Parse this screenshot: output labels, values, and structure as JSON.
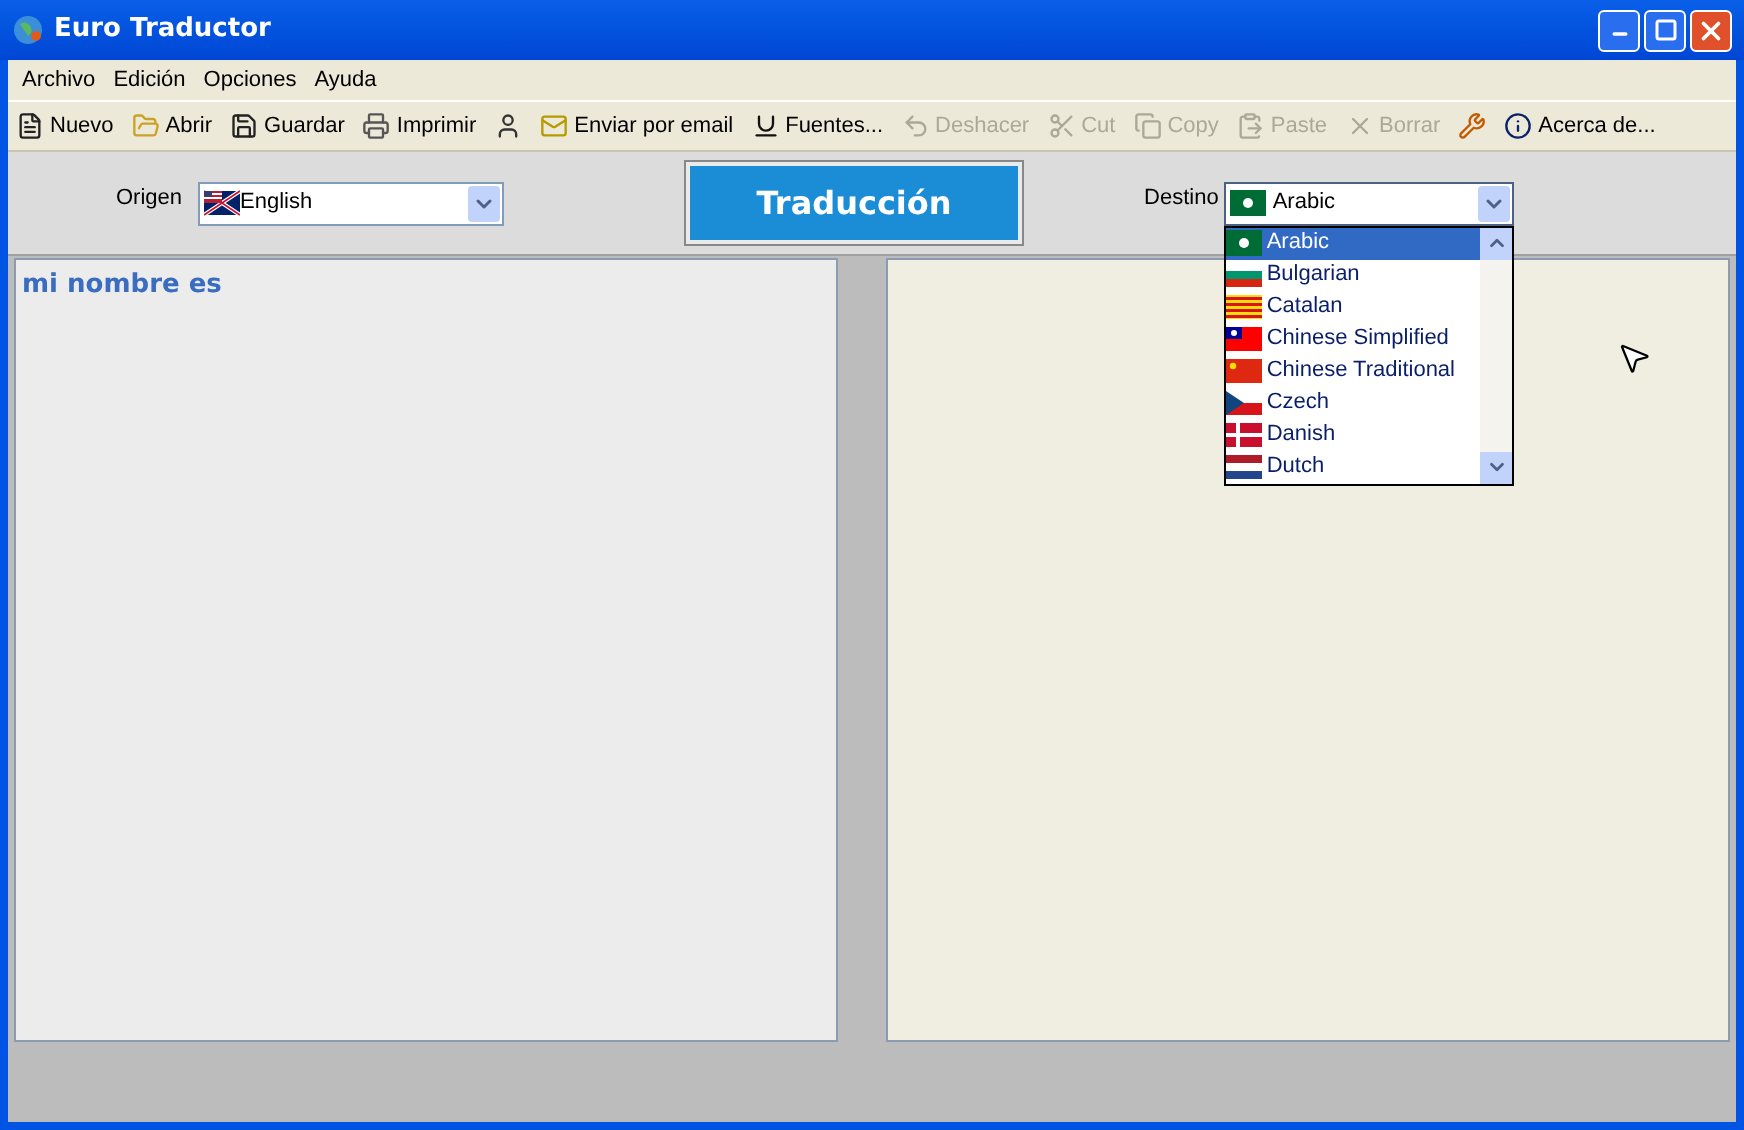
{
  "window": {
    "title": "Euro Traductor"
  },
  "menu": [
    "Archivo",
    "Edición",
    "Opciones",
    "Ayuda"
  ],
  "toolbar": [
    {
      "kind": "new",
      "label": "Nuevo",
      "disabled": false
    },
    {
      "kind": "open",
      "label": "Abrir",
      "disabled": false
    },
    {
      "kind": "save",
      "label": "Guardar",
      "disabled": false
    },
    {
      "kind": "print",
      "label": "Imprimir",
      "disabled": false
    },
    {
      "kind": "user",
      "disabled": false
    },
    {
      "kind": "mail",
      "label": "Enviar por email",
      "disabled": false
    },
    {
      "kind": "font",
      "label": "Fuentes...",
      "disabled": false
    },
    {
      "kind": "undo",
      "label": "Deshacer",
      "disabled": true
    },
    {
      "kind": "cut",
      "label": "Cut",
      "disabled": true
    },
    {
      "kind": "copy",
      "label": "Copy",
      "disabled": true
    },
    {
      "kind": "paste",
      "label": "Paste",
      "disabled": true
    },
    {
      "kind": "delete",
      "label": "Borrar",
      "disabled": true
    },
    {
      "kind": "tools",
      "disabled": false
    },
    {
      "kind": "info",
      "label": "Acerca de...",
      "disabled": false
    }
  ],
  "origin": {
    "label": "Origen",
    "value": "English",
    "kind": "us-uk"
  },
  "translate_button": "Traducción",
  "destination": {
    "label": "Destino",
    "value": "Arabic",
    "kind": "sa",
    "expanded": true,
    "options": [
      {
        "label": "Arabic",
        "kind": "sa",
        "selected": true
      },
      {
        "label": "Bulgarian",
        "kind": "bg",
        "selected": false
      },
      {
        "label": "Catalan",
        "kind": "ca",
        "selected": false
      },
      {
        "label": "Chinese Simplified",
        "kind": "tw",
        "selected": false
      },
      {
        "label": "Chinese Traditional",
        "kind": "cn",
        "selected": false
      },
      {
        "label": "Czech",
        "kind": "cz",
        "selected": false
      },
      {
        "label": "Danish",
        "kind": "dk",
        "selected": false
      },
      {
        "label": "Dutch",
        "kind": "nl",
        "selected": false
      }
    ]
  },
  "source_text": "mi nombre es"
}
